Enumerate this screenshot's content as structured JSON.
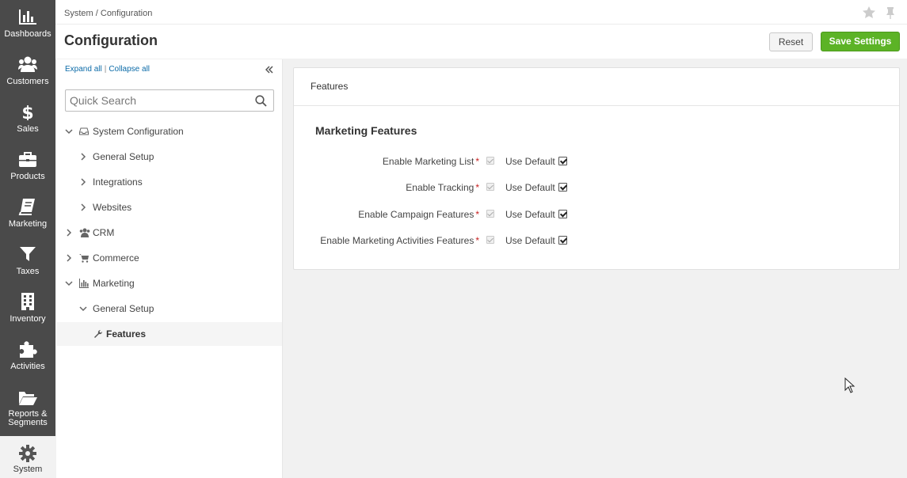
{
  "nav": {
    "items": [
      {
        "label": "Dashboards",
        "icon": "dashboards-icon"
      },
      {
        "label": "Customers",
        "icon": "customers-icon"
      },
      {
        "label": "Sales",
        "icon": "dollar-icon"
      },
      {
        "label": "Products",
        "icon": "briefcase-icon"
      },
      {
        "label": "Marketing",
        "icon": "book-icon"
      },
      {
        "label": "Taxes",
        "icon": "funnel-icon"
      },
      {
        "label": "Inventory",
        "icon": "building-icon"
      },
      {
        "label": "Activities",
        "icon": "puzzle-icon"
      },
      {
        "label": "Reports &\nSegments",
        "icon": "folder-icon"
      },
      {
        "label": "System",
        "icon": "gear-icon"
      }
    ],
    "active": "System"
  },
  "header": {
    "breadcrumb": [
      "System",
      "Configuration"
    ],
    "breadcrumb_sep": "/",
    "title": "Configuration",
    "reset_label": "Reset",
    "save_label": "Save Settings"
  },
  "tree": {
    "expand_all": "Expand all",
    "separator": "|",
    "collapse_all": "Collapse all",
    "search_placeholder": "Quick Search",
    "items": [
      {
        "label": "System Configuration",
        "level": 0,
        "expanded": true,
        "icon": "inbox-icon"
      },
      {
        "label": "General Setup",
        "level": 1,
        "expanded": false
      },
      {
        "label": "Integrations",
        "level": 1,
        "expanded": false
      },
      {
        "label": "Websites",
        "level": 1,
        "expanded": false
      },
      {
        "label": "CRM",
        "level": 0,
        "expanded": false,
        "icon": "users-icon"
      },
      {
        "label": "Commerce",
        "level": 0,
        "expanded": false,
        "icon": "cart-icon"
      },
      {
        "label": "Marketing",
        "level": 0,
        "expanded": true,
        "icon": "bar-chart-icon"
      },
      {
        "label": "General Setup",
        "level": 1,
        "expanded": true
      },
      {
        "label": "Features",
        "level": 2,
        "selected": true,
        "icon": "wrench-icon"
      }
    ]
  },
  "main": {
    "panel_title": "Features",
    "section_title": "Marketing Features",
    "use_default_label": "Use Default",
    "required_mark": "*",
    "fields": [
      {
        "label": "Enable Marketing List",
        "value": true,
        "use_default": true
      },
      {
        "label": "Enable Tracking",
        "value": true,
        "use_default": true
      },
      {
        "label": "Enable Campaign Features",
        "value": true,
        "use_default": true
      },
      {
        "label": "Enable Marketing Activities Features",
        "value": true,
        "use_default": true
      }
    ]
  },
  "colors": {
    "nav_bg": "#4a4a4a",
    "save_button": "#5cb326",
    "link": "#0c6ba8",
    "required": "#c71f1f"
  }
}
